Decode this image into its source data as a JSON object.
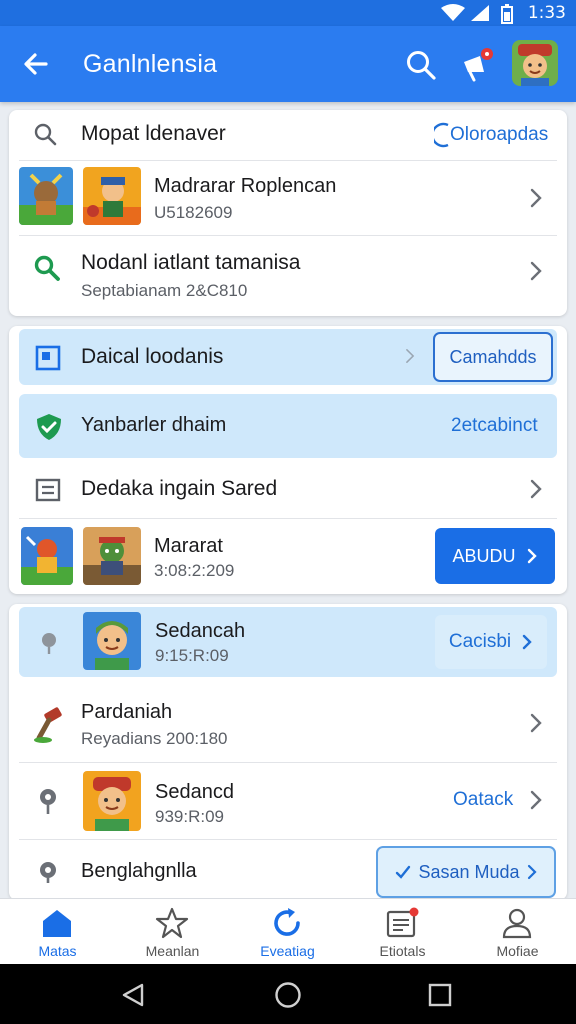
{
  "status_bar": {
    "time": "1:33",
    "icons": [
      "wifi-icon",
      "signal-icon",
      "battery-icon"
    ]
  },
  "app_bar": {
    "title": "Ganlnlensia",
    "back_icon": "arrow-left-icon",
    "search_icon": "search-icon",
    "notification_icon": "megaphone-icon"
  },
  "card1": {
    "search": {
      "placeholder": "Mopat ldenaver",
      "action": "Oloroapdas"
    },
    "row1": {
      "title": "Madrarar Roplencan",
      "subtitle": "U5182609"
    },
    "row2": {
      "title": "Nodanl iatlant tamanisa",
      "subtitle": "Septabianam 2&C810"
    }
  },
  "card2": {
    "row1": {
      "title": "Daical loodanis",
      "button": "Camahdds"
    },
    "row2": {
      "title": "Yanbarler dhaim",
      "action": "2etcabinct"
    },
    "row3": {
      "title": "Dedaka ingain Sared"
    },
    "row4": {
      "title": "Mararat",
      "subtitle": "3:08:2:209",
      "button": "ABUDU"
    }
  },
  "card3": {
    "row1": {
      "title": "Sedancah",
      "subtitle": "9:15:R:09",
      "action": "Cacisbi"
    },
    "row2": {
      "title": "Pardaniah",
      "subtitle": "Reyadians 200:180"
    },
    "row3": {
      "title": "Sedancd",
      "subtitle": "939:R:09",
      "action": "Oatack"
    },
    "row4": {
      "title": "Benglahgnlla",
      "button": "Sasan Muda"
    }
  },
  "bottom_nav": {
    "items": [
      {
        "label": "Matas",
        "icon": "home-icon",
        "active": true
      },
      {
        "label": "Meanlan",
        "icon": "star-icon",
        "active": false
      },
      {
        "label": "Eveatiag",
        "icon": "refresh-icon",
        "active": false
      },
      {
        "label": "Etiotals",
        "icon": "list-icon",
        "active": false
      },
      {
        "label": "Mofiae",
        "icon": "person-icon",
        "active": false
      }
    ]
  },
  "colors": {
    "primary": "#2b7cf0",
    "accent": "#1a6ee6",
    "highlight": "#cfe8fb",
    "link": "#1f6fd6"
  }
}
